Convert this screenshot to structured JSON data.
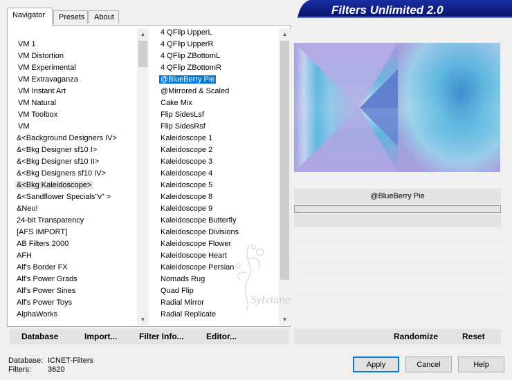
{
  "tabs": [
    {
      "label": "Navigator",
      "active": true
    },
    {
      "label": "Presets",
      "active": false
    },
    {
      "label": "About",
      "active": false
    }
  ],
  "title": "Filters Unlimited 2.0",
  "categories": [
    "VM 1",
    "VM Distortion",
    "VM Experimental",
    "VM Extravaganza",
    "VM Instant Art",
    "VM Natural",
    "VM Toolbox",
    "VM",
    "&<Background Designers IV>",
    "&<Bkg Designer sf10 I>",
    "&<Bkg Designer sf10 II>",
    "&<Bkg Designers sf10 IV>",
    "&<Bkg Kaleidoscope>",
    "&<Sandflower Specials\"v\" >",
    "&Neu!",
    "24-bit Transparency",
    "[AFS IMPORT]",
    "AB Filters 2000",
    "AFH",
    "Alf's Border FX",
    "Alf's Power Grads",
    "Alf's Power Sines",
    "Alf's Power Toys",
    "AlphaWorks"
  ],
  "highlighted_category": "&<Bkg Kaleidoscope>",
  "filters": [
    "4 QFlip UpperL",
    "4 QFlip UpperR",
    "4 QFlip ZBottomL",
    "4 QFlip ZBottomR",
    "@BlueBerry Pie",
    "@Mirrored & Scaled",
    "Cake Mix",
    "Flip SidesLsf",
    "Flip SidesRsf",
    "Kaleidoscope 1",
    "Kaleidoscope 2",
    "Kaleidoscope 3",
    "Kaleidoscope 4",
    "Kaleidoscope 5",
    "Kaleidoscope 8",
    "Kaleidoscope 9",
    "Kaleidoscope Butterfly",
    "Kaleidoscope Divisions",
    "Kaleidoscope Flower",
    "Kaleidoscope Heart",
    "Kaleidoscope Persian",
    "Nomads Rug",
    "Quad Flip",
    "Radial Mirror",
    "Radial Replicate"
  ],
  "selected_filter": "@BlueBerry Pie",
  "toolbar": {
    "database_label": "Database",
    "import_label": "Import...",
    "filter_info_label": "Filter Info...",
    "editor_label": "Editor..."
  },
  "preview": {
    "filter_name": "@BlueBerry Pie",
    "randomize_label": "Randomize",
    "reset_label": "Reset"
  },
  "status": {
    "database_label": "Database:",
    "database_value": "ICNET-Filters",
    "filters_label": "Filters:",
    "filters_value": "3620"
  },
  "buttons": {
    "apply": "Apply",
    "cancel": "Cancel",
    "help": "Help"
  },
  "watermark_text": "Sylviane",
  "colors": {
    "selection": "#0078d7",
    "banner": "#0b1e8a",
    "preview_purple": "#b4a4d8",
    "preview_blue": "#3aa8d4"
  }
}
